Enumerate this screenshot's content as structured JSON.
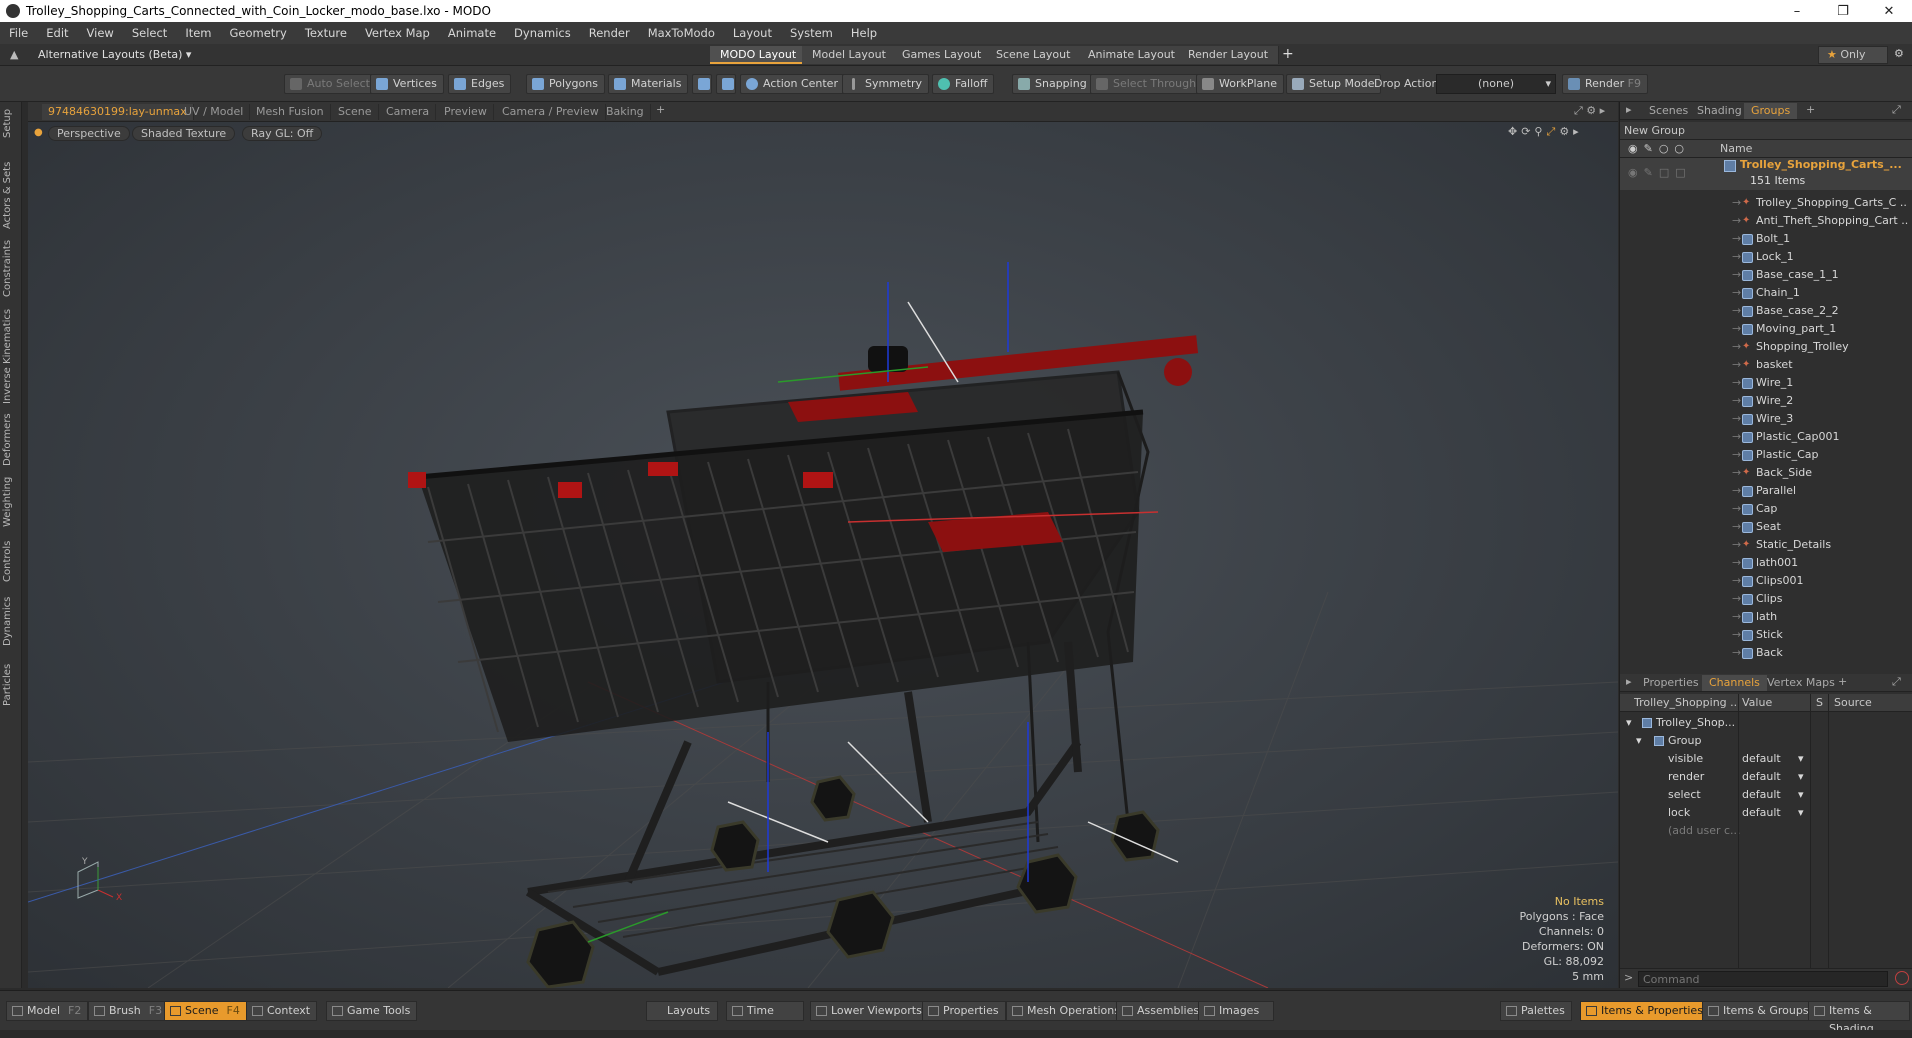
{
  "window": {
    "title": "Trolley_Shopping_Carts_Connected_with_Coin_Locker_modo_base.lxo - MODO"
  },
  "menu": [
    "File",
    "Edit",
    "View",
    "Select",
    "Item",
    "Geometry",
    "Texture",
    "Vertex Map",
    "Animate",
    "Dynamics",
    "Render",
    "MaxToModo",
    "Layout",
    "System",
    "Help"
  ],
  "layoutbar": {
    "alt_layouts": "Alternative Layouts (Beta)",
    "tabs": [
      "MODO Layout",
      "Model Layout",
      "Games Layout",
      "Scene Layout",
      "Animate Layout",
      "Render Layout"
    ],
    "active_tab": "MODO Layout",
    "only_label": "Only"
  },
  "toolbar": {
    "auto_select": "Auto Select",
    "vertices": "Vertices",
    "edges": "Edges",
    "polygons": "Polygons",
    "materials": "Materials",
    "action_center": "Action Center",
    "symmetry": "Symmetry",
    "falloff": "Falloff",
    "snapping": "Snapping",
    "select_through": "Select Through",
    "workplane": "WorkPlane",
    "setup_mode": "Setup Mode",
    "drop_action": "Drop Action",
    "drop_value": "(none)",
    "render": "Render",
    "render_key": "F9"
  },
  "left_tabs": [
    "Setup",
    "Actors & Sets",
    "Constraints",
    "Inverse Kinematics",
    "Deformers",
    "Weighting",
    "Controls",
    "Dynamics",
    "Particles"
  ],
  "viewport_tabs": [
    "97484630199:lay-unmax",
    "UV / Model",
    "Mesh Fusion",
    "Scene",
    "Camera",
    "Preview",
    "Camera / Preview",
    "Baking"
  ],
  "viewport": {
    "perspective": "Perspective",
    "shading": "Shaded Texture",
    "raygl": "Ray GL: Off",
    "info": {
      "items": "No Items",
      "polygons": "Polygons : Face",
      "channels": "Channels: 0",
      "deformers": "Deformers: ON",
      "gl": "GL: 88,092",
      "scale": "5 mm"
    }
  },
  "scene_panel": {
    "tabs": [
      "Scenes",
      "Shading",
      "Groups"
    ],
    "active_tab": "Groups",
    "new_group": "New Group",
    "col_name": "Name",
    "group_name": "Trolley_Shopping_Carts_...",
    "group_count": "151 Items",
    "items": [
      {
        "name": "Trolley_Shopping_Carts_C ...",
        "icon": "locator-icon"
      },
      {
        "name": "Anti_Theft_Shopping_Cart ...",
        "icon": "locator-icon"
      },
      {
        "name": "Bolt_1",
        "icon": "mesh-icon"
      },
      {
        "name": "Lock_1",
        "icon": "mesh-icon"
      },
      {
        "name": "Base_case_1_1",
        "icon": "mesh-icon"
      },
      {
        "name": "Chain_1",
        "icon": "mesh-icon"
      },
      {
        "name": "Base_case_2_2",
        "icon": "mesh-icon"
      },
      {
        "name": "Moving_part_1",
        "icon": "mesh-icon"
      },
      {
        "name": "Shopping_Trolley",
        "icon": "locator-icon"
      },
      {
        "name": "basket",
        "icon": "locator-icon"
      },
      {
        "name": "Wire_1",
        "icon": "mesh-icon"
      },
      {
        "name": "Wire_2",
        "icon": "mesh-icon"
      },
      {
        "name": "Wire_3",
        "icon": "mesh-icon"
      },
      {
        "name": "Plastic_Cap001",
        "icon": "mesh-icon"
      },
      {
        "name": "Plastic_Cap",
        "icon": "mesh-icon"
      },
      {
        "name": "Back_Side",
        "icon": "locator-icon"
      },
      {
        "name": "Parallel",
        "icon": "mesh-icon"
      },
      {
        "name": "Cap",
        "icon": "mesh-icon"
      },
      {
        "name": "Seat",
        "icon": "mesh-icon"
      },
      {
        "name": "Static_Details",
        "icon": "locator-icon"
      },
      {
        "name": "lath001",
        "icon": "mesh-icon"
      },
      {
        "name": "Clips001",
        "icon": "mesh-icon"
      },
      {
        "name": "Clips",
        "icon": "mesh-icon"
      },
      {
        "name": "lath",
        "icon": "mesh-icon"
      },
      {
        "name": "Stick",
        "icon": "mesh-icon"
      },
      {
        "name": "Back",
        "icon": "mesh-icon"
      }
    ]
  },
  "channels_panel": {
    "tabs": [
      "Properties",
      "Channels",
      "Vertex Maps"
    ],
    "active_tab": "Channels",
    "col_item": "Trolley_Shopping ...",
    "col_value": "Value",
    "col_s": "S",
    "col_source": "Source",
    "root": "Trolley_Shop...",
    "group": "Group",
    "rows": [
      {
        "name": "visible",
        "value": "default"
      },
      {
        "name": "render",
        "value": "default"
      },
      {
        "name": "select",
        "value": "default"
      },
      {
        "name": "lock",
        "value": "default"
      }
    ],
    "add_user": "(add user c...",
    "command_placeholder": "Command"
  },
  "bottombar": {
    "model": "Model",
    "model_key": "F2",
    "brush": "Brush",
    "brush_key": "F3",
    "scene": "Scene",
    "scene_key": "F4",
    "context": "Context",
    "game_tools": "Game Tools",
    "layouts": "Layouts",
    "time": "Time",
    "lower_viewports": "Lower Viewports",
    "properties": "Properties",
    "mesh_operations": "Mesh Operations",
    "assemblies": "Assemblies",
    "images": "Images",
    "palettes": "Palettes",
    "items_properties": "Items & Properties",
    "items_groups": "Items & Groups",
    "items_shading": "Items & Shading"
  },
  "colors": {
    "accent": "#e8a33c",
    "cart_red": "#8c1010",
    "cart_frame": "#1c1c1c"
  }
}
